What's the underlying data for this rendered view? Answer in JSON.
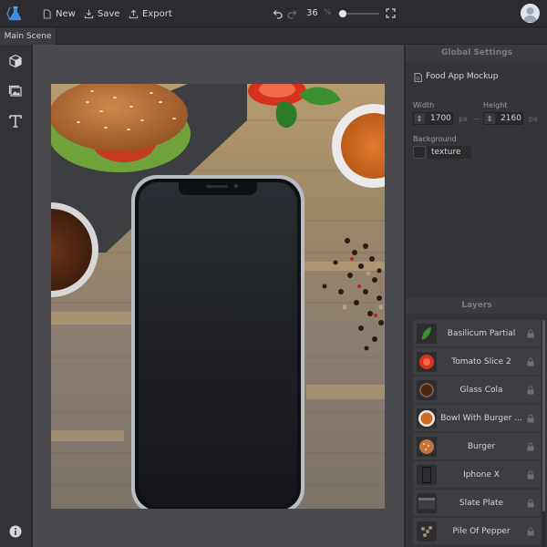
{
  "toolbar": {
    "new_label": "New",
    "save_label": "Save",
    "export_label": "Export",
    "zoom_value": "36",
    "zoom_unit": "%",
    "zoom_level": 0.1
  },
  "tabs": [
    {
      "label": "Main Scene"
    }
  ],
  "global_settings": {
    "title": "Global Settings",
    "document_name": "Food App Mockup",
    "width_label": "Width",
    "width_value": "1700",
    "width_unit": "px",
    "link_symbol": "—",
    "height_label": "Height",
    "height_value": "2160",
    "height_unit": "px",
    "background_label": "Background",
    "background_value": "texture"
  },
  "layers": {
    "title": "Layers",
    "items": [
      {
        "name": "Basilicum Partial"
      },
      {
        "name": "Tomato Slice 2"
      },
      {
        "name": "Glass Cola"
      },
      {
        "name": "Bowl With Burger ..."
      },
      {
        "name": "Burger"
      },
      {
        "name": "Iphone X"
      },
      {
        "name": "Slate Plate"
      },
      {
        "name": "Pile Of Pepper"
      }
    ]
  },
  "colors": {
    "accent": "#4a90d9",
    "panel": "#353539",
    "canvas": "#4a4a4e",
    "topbar": "#2c2c30"
  }
}
